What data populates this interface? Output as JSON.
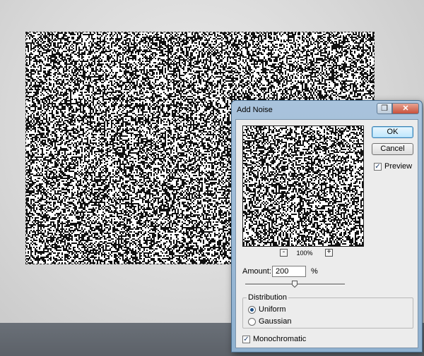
{
  "dialog": {
    "title": "Add Noise",
    "ok_label": "OK",
    "cancel_label": "Cancel",
    "preview_label": "Preview",
    "preview_checked": true,
    "zoom_out_label": "-",
    "zoom_in_label": "+",
    "zoom_level": "100%",
    "amount_label": "Amount:",
    "amount_value": "200",
    "amount_unit": "%",
    "distribution_label": "Distribution",
    "distribution_options": [
      "Uniform",
      "Gaussian"
    ],
    "distribution_selected": "Uniform",
    "monochromatic_label": "Monochromatic",
    "monochromatic_checked": true,
    "minimize_icon": "restore-icon",
    "close_icon": "close-icon"
  },
  "colors": {
    "titlebar": "#9bb8d6",
    "close_button": "#c8513c",
    "dialog_body": "#ececec",
    "workspace_bottom": "#5f646b"
  }
}
